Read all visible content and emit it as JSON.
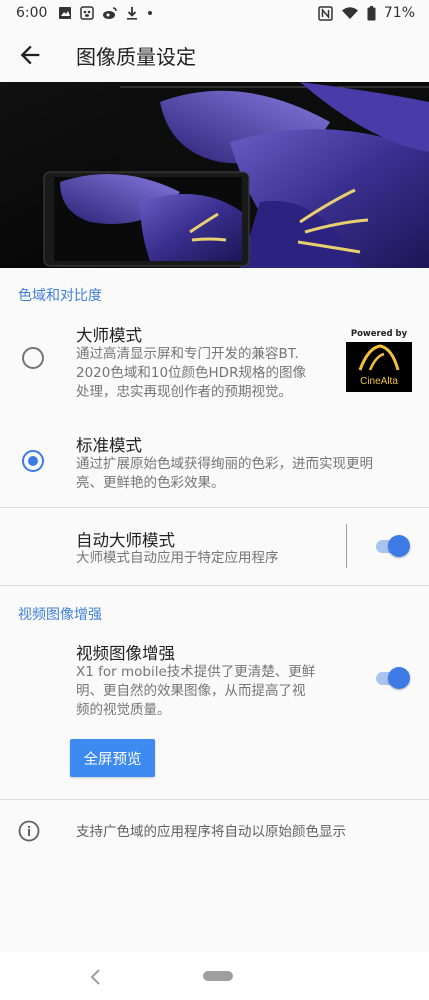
{
  "status": {
    "time": "6:00",
    "battery": "71%",
    "left_icons": [
      "image-icon",
      "paw-icon",
      "weibo-icon",
      "download-icon",
      "dot-icon"
    ],
    "right_icons": [
      "nfc-icon",
      "wifi-icon",
      "battery-icon"
    ]
  },
  "appbar": {
    "title": "图像质量设定"
  },
  "hero": {
    "description": "Sony TV and phone displaying purple flower"
  },
  "color_section": {
    "header": "色域和对比度",
    "master_mode": {
      "title": "大师模式",
      "desc_lines": [
        "通过高清显示屏和专门开发的兼容BT.",
        "2020色域和10位颜色HDR规格的图像",
        "处理，忠实再现创作者的预期视觉。"
      ],
      "selected": false,
      "badge_powered": "Powered by",
      "badge_brand": "CineAlta"
    },
    "standard_mode": {
      "title": "标准模式",
      "desc_lines": [
        "通过扩展原始色域获得绚丽的色彩，进而实现更明",
        "亮、更鲜艳的色彩效果。"
      ],
      "selected": true
    },
    "auto_master": {
      "title": "自动大师模式",
      "desc": "大师模式自动应用于特定应用程序",
      "enabled": true
    }
  },
  "video_section": {
    "header": "视频图像增强",
    "enhance": {
      "title": "视频图像增强",
      "desc_lines": [
        "X1 for mobile技术提供了更清楚、更鲜",
        "明、更自然的效果图像，从而提高了视",
        "频的视觉质量。"
      ],
      "enabled": true
    },
    "preview_button": "全屏预览"
  },
  "info": {
    "text": "支持广色域的应用程序将自动以原始颜色显示"
  },
  "colors": {
    "accent": "#3d7ae6",
    "section_header": "#3f7fd9",
    "button": "#3d8af0"
  }
}
